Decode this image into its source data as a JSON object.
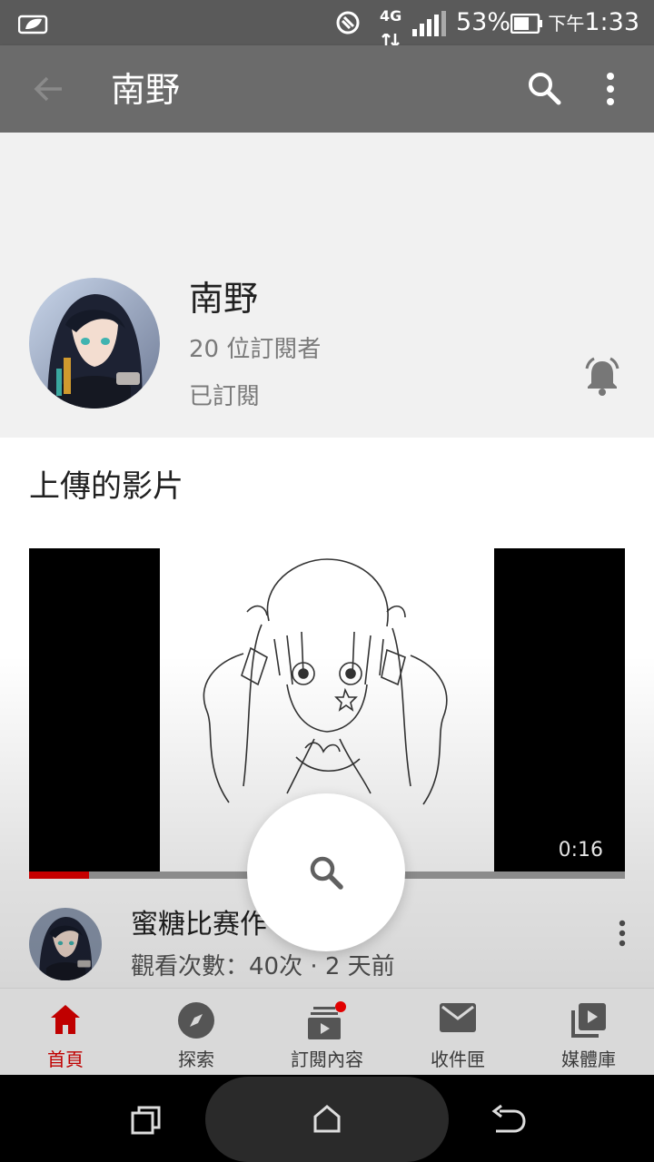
{
  "status_bar": {
    "network": "4G",
    "battery": "53%",
    "ampm": "下午",
    "time": "1:33"
  },
  "app_bar": {
    "title": "南野"
  },
  "channel": {
    "name": "南野",
    "subscribers": "20 位訂閱者",
    "subscribed_label": "已訂閱"
  },
  "section": {
    "title": "上傳的影片"
  },
  "video": {
    "duration": "0:16",
    "progress": 0.1,
    "title": "蜜糖比赛作",
    "meta": "觀看次數：40次 · 2 天前"
  },
  "bottom_nav": {
    "items": [
      {
        "label": "首頁",
        "icon": "home-icon",
        "active": true
      },
      {
        "label": "探索",
        "icon": "explore-icon",
        "active": false
      },
      {
        "label": "訂閱內容",
        "icon": "subscriptions-icon",
        "active": false
      },
      {
        "label": "收件匣",
        "icon": "inbox-icon",
        "active": false
      },
      {
        "label": "媒體庫",
        "icon": "library-icon",
        "active": false
      }
    ]
  },
  "colors": {
    "accent": "#e10000",
    "app_bar": "#6b6b6b",
    "status_bar": "#5a5a5a"
  }
}
